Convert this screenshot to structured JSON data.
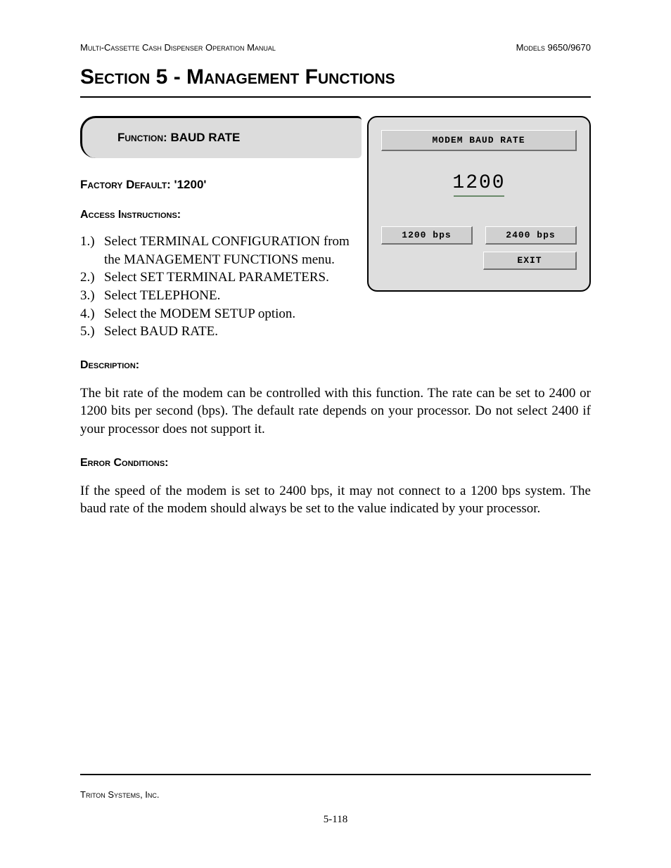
{
  "header": {
    "left": "Multi-Cassette Cash Dispenser Operation Manual",
    "right": "Models 9650/9670"
  },
  "section_title": "Section 5 - Management Functions",
  "function_box": {
    "label": "Function:",
    "value": "BAUD RATE"
  },
  "factory_default": "Factory Default: '1200'",
  "access_label": "Access Instructions:",
  "steps": [
    {
      "n": "1.)",
      "t": "Select TERMINAL CONFIGURATION from the MANAGEMENT FUNCTIONS menu."
    },
    {
      "n": "2.)",
      "t": "Select SET TERMINAL PARAMETERS."
    },
    {
      "n": "3.)",
      "t": "Select TELEPHONE."
    },
    {
      "n": "4.)",
      "t": "Select the MODEM SETUP option."
    },
    {
      "n": "5.)",
      "t": "Select BAUD RATE."
    }
  ],
  "description_label": "Description:",
  "description_text": "The bit rate of the modem can be controlled with this function.  The rate can be set to 2400 or 1200 bits per second (bps).  The default rate depends on your processor.  Do not select 2400 if your processor does not support it.",
  "error_label": "Error Conditions:",
  "error_text": "If the speed of the modem is set to 2400 bps, it may not connect to a 1200  bps system.  The baud rate of the modem should always be set to the value indicated by your processor.",
  "terminal": {
    "title": "MODEM BAUD RATE",
    "value": "1200",
    "btn1": "1200 bps",
    "btn2": "2400 bps",
    "exit": "EXIT"
  },
  "footer": {
    "company": "Triton Systems, Inc.",
    "page": "5-118"
  }
}
